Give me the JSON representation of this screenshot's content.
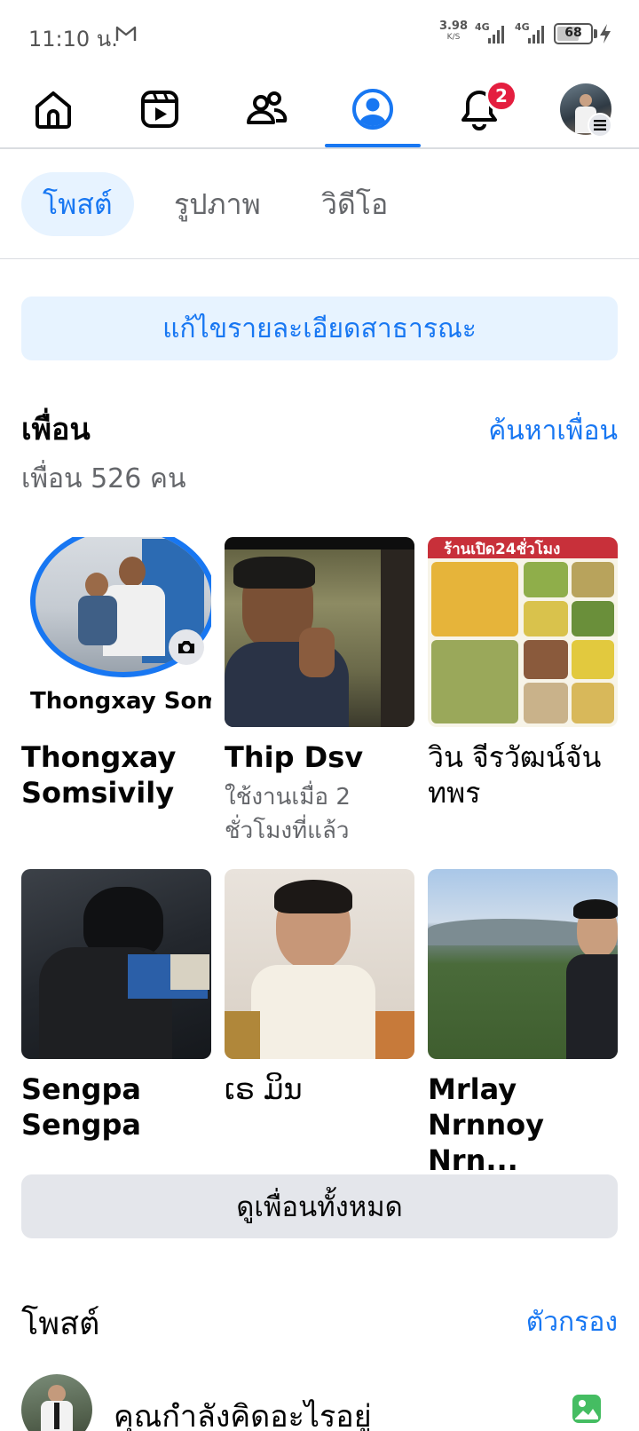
{
  "status": {
    "time": "11:10 น.",
    "net_speed_value": "3.98",
    "net_speed_unit": "K/S",
    "signal1_label": "4G",
    "signal2_label": "4G",
    "battery_percent": "68",
    "battery_level": 0.68
  },
  "nav": {
    "notification_count": "2",
    "active_tab": "profile"
  },
  "sub_tabs": [
    "โพสต์",
    "รูปภาพ",
    "วิดีโอ"
  ],
  "edit_details_label": "แก้ไขรายละเอียดสาธารณะ",
  "friends": {
    "title": "เพื่อน",
    "count_text": "เพื่อน 526 คน",
    "find_link": "ค้นหาเพื่อน",
    "items": [
      {
        "name": "Thongxay Somsivily",
        "sub": "",
        "photo_caption": "Thongxay Som"
      },
      {
        "name": "Thip Dsv",
        "sub": "ใช้งานเมื่อ 2 ชั่วโมงที่แล้ว"
      },
      {
        "name": "วิน จีรวัฒน์จันทพร",
        "sub": "",
        "photo_caption": "ร้านเปิด24ชั่วโมง"
      },
      {
        "name": "Sengpa Sengpa",
        "sub": ""
      },
      {
        "name": "ເຣ ມິນ",
        "sub": ""
      },
      {
        "name": "Mrlay Nrnnoy Nrn...",
        "sub": ""
      }
    ],
    "see_all_label": "ดูเพื่อนทั้งหมด"
  },
  "posts": {
    "title": "โพสต์",
    "filter_link": "ตัวกรอง",
    "composer_placeholder": "คุณกำลังคิดอะไรอยู่"
  },
  "colors": {
    "accent": "#1877f2",
    "accent_light": "#e7f3ff",
    "badge": "#e41e3f",
    "secondary_text": "#65676b",
    "button_gray": "#e4e6eb"
  }
}
